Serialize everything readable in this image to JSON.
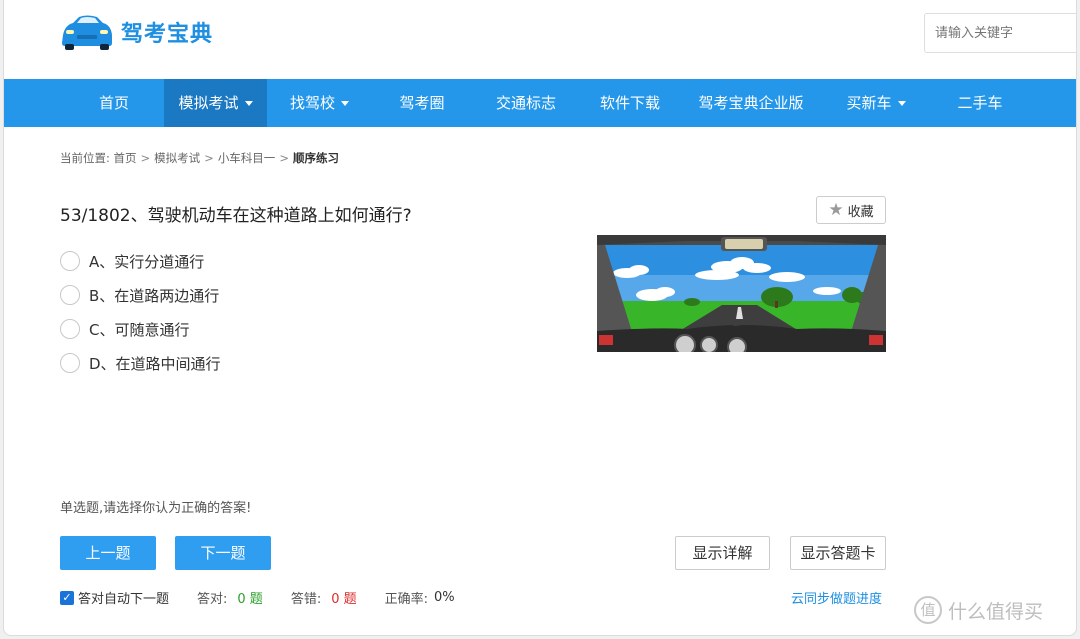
{
  "header": {
    "logo_text": "驾考宝典",
    "search_placeholder": "请输入关键字"
  },
  "nav": {
    "items": [
      {
        "label": "首页"
      },
      {
        "label": "模拟考试"
      },
      {
        "label": "找驾校"
      },
      {
        "label": "驾考圈"
      },
      {
        "label": "交通标志"
      },
      {
        "label": "软件下载"
      },
      {
        "label": "驾考宝典企业版"
      },
      {
        "label": "买新车"
      },
      {
        "label": "二手车"
      }
    ]
  },
  "breadcrumb": {
    "prefix": "当前位置:",
    "items": [
      "首页",
      "模拟考试",
      "小车科目一",
      "顺序练习"
    ],
    "separator": ">"
  },
  "question": {
    "text": "53/1802、驾驶机动车在这种道路上如何通行?",
    "favorite_label": "收藏",
    "options": [
      {
        "label": "A、实行分道通行"
      },
      {
        "label": "B、在道路两边通行"
      },
      {
        "label": "C、可随意通行"
      },
      {
        "label": "D、在道路中间通行"
      }
    ],
    "hint": "单选题,请选择你认为正确的答案!"
  },
  "buttons": {
    "prev": "上一题",
    "next": "下一题",
    "show_explain": "显示详解",
    "show_card": "显示答题卡"
  },
  "stats": {
    "auto_next_label": "答对自动下一题",
    "correct_label": "答对:",
    "correct_value": "0 题",
    "wrong_label": "答错:",
    "wrong_value": "0 题",
    "rate_label": "正确率:",
    "rate_value": "0%"
  },
  "sync_link": "云同步做题进度",
  "watermark": "什么值得买",
  "watermark_glyph": "值",
  "colors": {
    "nav_bg": "#2597ea",
    "nav_active": "#1b78c2",
    "button_blue": "#2f9ef1",
    "link_blue": "#1e8fe1",
    "correct_green": "#2aa02a",
    "wrong_red": "#e02b2b"
  }
}
